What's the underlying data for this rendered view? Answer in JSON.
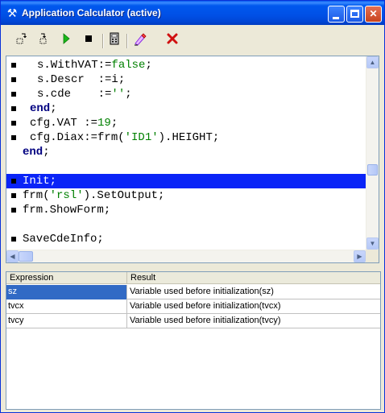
{
  "window": {
    "title": "Application Calculator (active)",
    "title_icon": "hammer-wrench-icon"
  },
  "toolbar": {
    "items": [
      {
        "name": "step-into-icon",
        "glyph": "↳"
      },
      {
        "name": "step-over-icon",
        "glyph": "↷"
      },
      {
        "name": "run-icon",
        "glyph": "▶"
      },
      {
        "name": "stop-icon",
        "glyph": "■"
      },
      {
        "name": "calculator-icon",
        "glyph": "▦"
      },
      {
        "name": "clear-icon",
        "glyph": "✎"
      },
      {
        "name": "close-red-x-icon",
        "glyph": "✖"
      }
    ]
  },
  "code": {
    "lines": [
      {
        "bullet": true,
        "indent": 2,
        "tokens": [
          [
            "plain",
            "s.WithVAT:="
          ],
          [
            "str",
            "false"
          ],
          [
            "plain",
            ";"
          ]
        ]
      },
      {
        "bullet": true,
        "indent": 2,
        "tokens": [
          [
            "plain",
            "s.Descr  :=i;"
          ]
        ]
      },
      {
        "bullet": true,
        "indent": 2,
        "tokens": [
          [
            "plain",
            "s.cde    :="
          ],
          [
            "str",
            "''"
          ],
          [
            "plain",
            ";"
          ]
        ]
      },
      {
        "bullet": true,
        "indent": 1,
        "tokens": [
          [
            "kw",
            "end"
          ],
          [
            "plain",
            ";"
          ]
        ]
      },
      {
        "bullet": true,
        "indent": 1,
        "tokens": [
          [
            "plain",
            "cfg.VAT :="
          ],
          [
            "num",
            "19"
          ],
          [
            "plain",
            ";"
          ]
        ]
      },
      {
        "bullet": true,
        "indent": 1,
        "tokens": [
          [
            "plain",
            "cfg.Diax:=frm("
          ],
          [
            "str",
            "'ID1'"
          ],
          [
            "plain",
            ").HEIGHT;"
          ]
        ]
      },
      {
        "bullet": false,
        "indent": 0,
        "tokens": [
          [
            "kw",
            "end"
          ],
          [
            "plain",
            ";"
          ]
        ]
      },
      {
        "bullet": false,
        "indent": 0,
        "tokens": [
          [
            "plain",
            ""
          ]
        ]
      },
      {
        "bullet": true,
        "indent": 0,
        "selected": true,
        "tokens": [
          [
            "plain",
            "Init;"
          ]
        ]
      },
      {
        "bullet": true,
        "indent": 0,
        "tokens": [
          [
            "plain",
            "frm("
          ],
          [
            "str",
            "'rsl'"
          ],
          [
            "plain",
            ").SetOutput;"
          ]
        ]
      },
      {
        "bullet": true,
        "indent": 0,
        "tokens": [
          [
            "plain",
            "frm.ShowForm;"
          ]
        ]
      },
      {
        "bullet": false,
        "indent": 0,
        "tokens": [
          [
            "plain",
            ""
          ]
        ]
      },
      {
        "bullet": true,
        "indent": 0,
        "tokens": [
          [
            "plain",
            "SaveCdeInfo;"
          ]
        ]
      }
    ]
  },
  "watch": {
    "headers": {
      "expression": "Expression",
      "result": "Result"
    },
    "rows": [
      {
        "expression": "sz",
        "result": "Variable used before initialization(sz)",
        "selected": true
      },
      {
        "expression": "tvcx",
        "result": "Variable used before initialization(tvcx)",
        "selected": false
      },
      {
        "expression": "tvcy",
        "result": "Variable used before initialization(tvcy)",
        "selected": false
      }
    ]
  },
  "colors": {
    "selection": "#0a24f7",
    "grid_selection": "#316ac5",
    "string": "#008000",
    "keyword": "#000080"
  }
}
